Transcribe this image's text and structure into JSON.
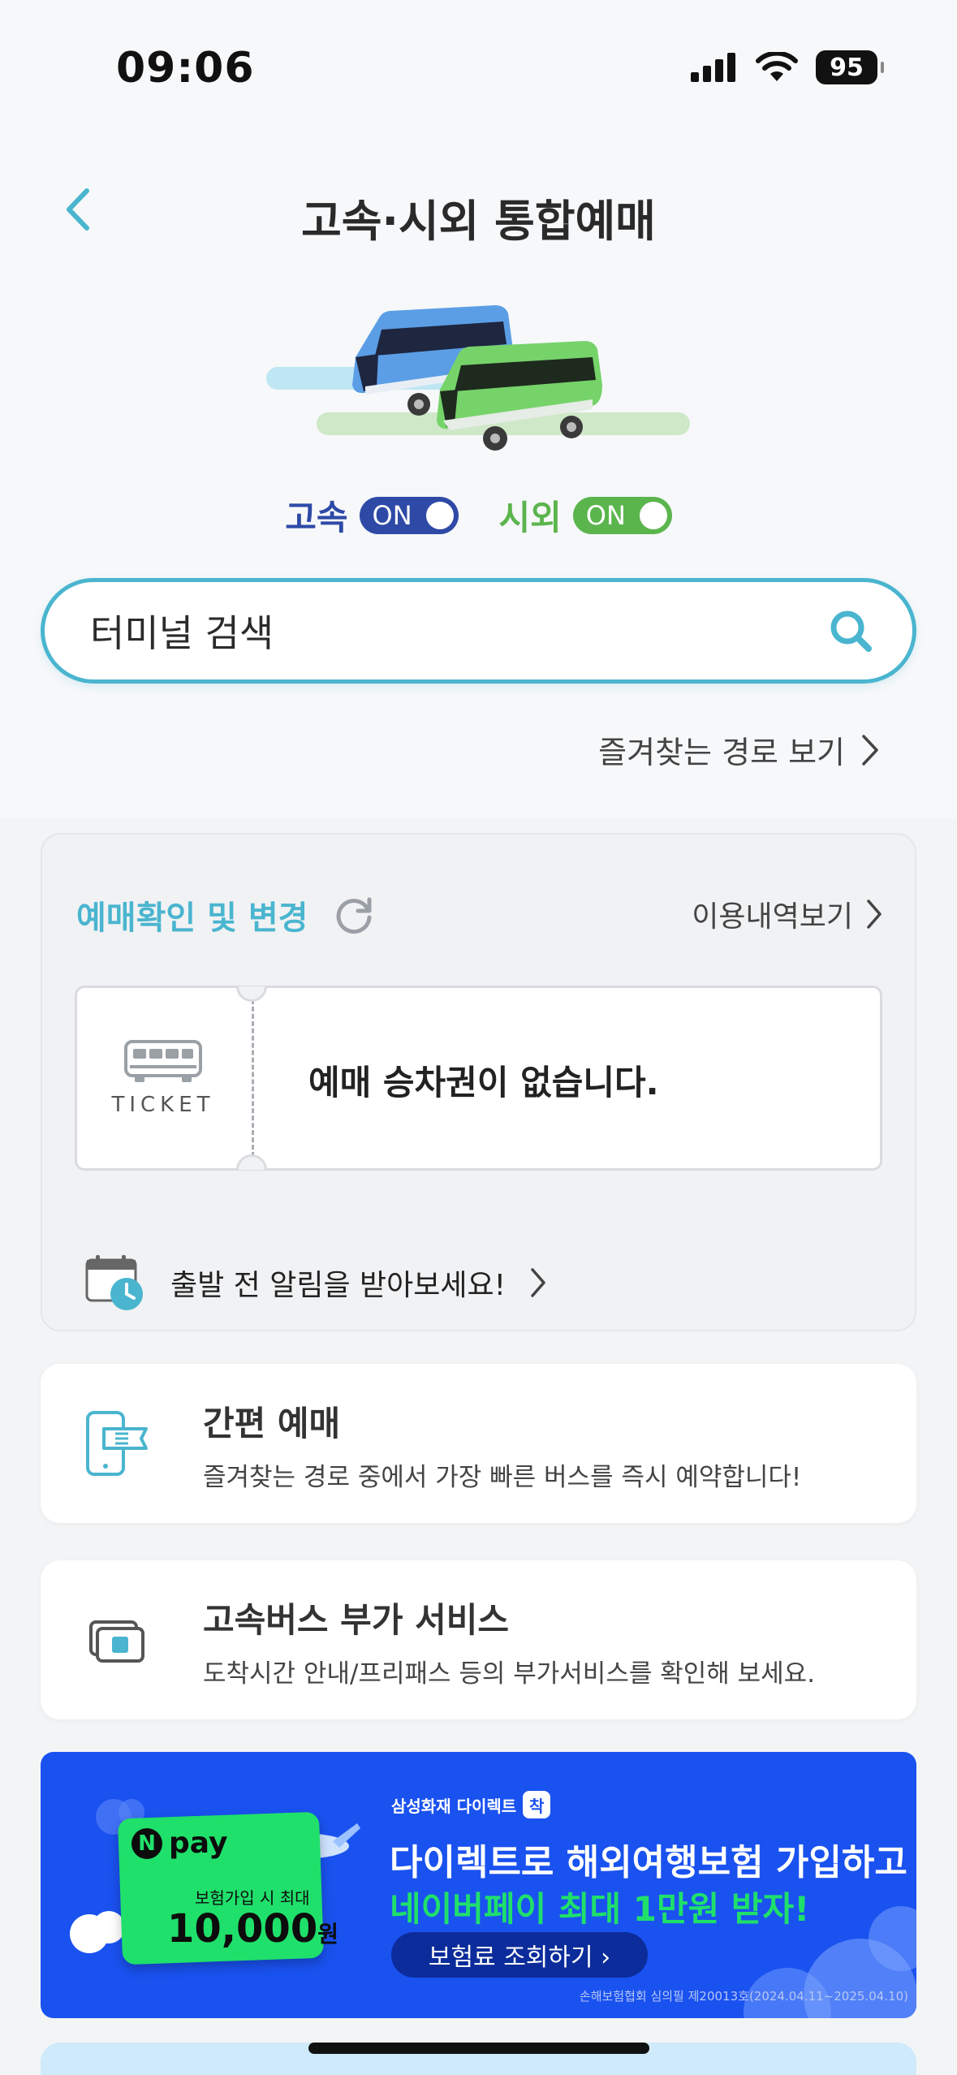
{
  "status_bar": {
    "time": "09:06",
    "battery": "95"
  },
  "header": {
    "title": "고속·시외 통합예매"
  },
  "toggles": [
    {
      "label": "고속",
      "state": "ON",
      "color": "#2e4aa6"
    },
    {
      "label": "시외",
      "state": "ON",
      "color": "#5bb54d"
    }
  ],
  "search": {
    "placeholder": "터미널 검색"
  },
  "favorites_link": "즐겨찾는 경로 보기",
  "reservation": {
    "title": "예매확인 및 변경",
    "history_link": "이용내역보기",
    "ticket_label": "TICKET",
    "empty_message": "예매 승차권이 없습니다.",
    "alarm_text": "출발 전 알림을 받아보세요!"
  },
  "services": [
    {
      "title": "간편 예매",
      "desc": "즐겨찾는 경로 중에서 가장 빠른 버스를 즉시 예약합니다!",
      "icon": "mobile-ticket-icon"
    },
    {
      "title": "고속버스 부가 서비스",
      "desc": "도착시간 안내/프리패스 등의 부가서비스를 확인해 보세요.",
      "icon": "extra-service-icon"
    }
  ],
  "banner": {
    "npay_logo": "pay",
    "npay_n": "N",
    "npay_sub": "보험가입 시 최대",
    "npay_amount": "10,000",
    "npay_unit": "원",
    "brand": "삼성화재 다이렉트",
    "brand_badge": "착",
    "line1": "다이렉트로 해외여행보험 가입하고",
    "line2": "네이버페이 최대 1만원 받자!",
    "button": "보험료 조회하기 ›",
    "legal": "손해보험협회 심의필 제20013호(2024.04.11~2025.04.10)"
  },
  "colors": {
    "accent": "#4ab5cf",
    "banner_bg": "#1a52f0",
    "npay_green": "#1fe06b"
  }
}
